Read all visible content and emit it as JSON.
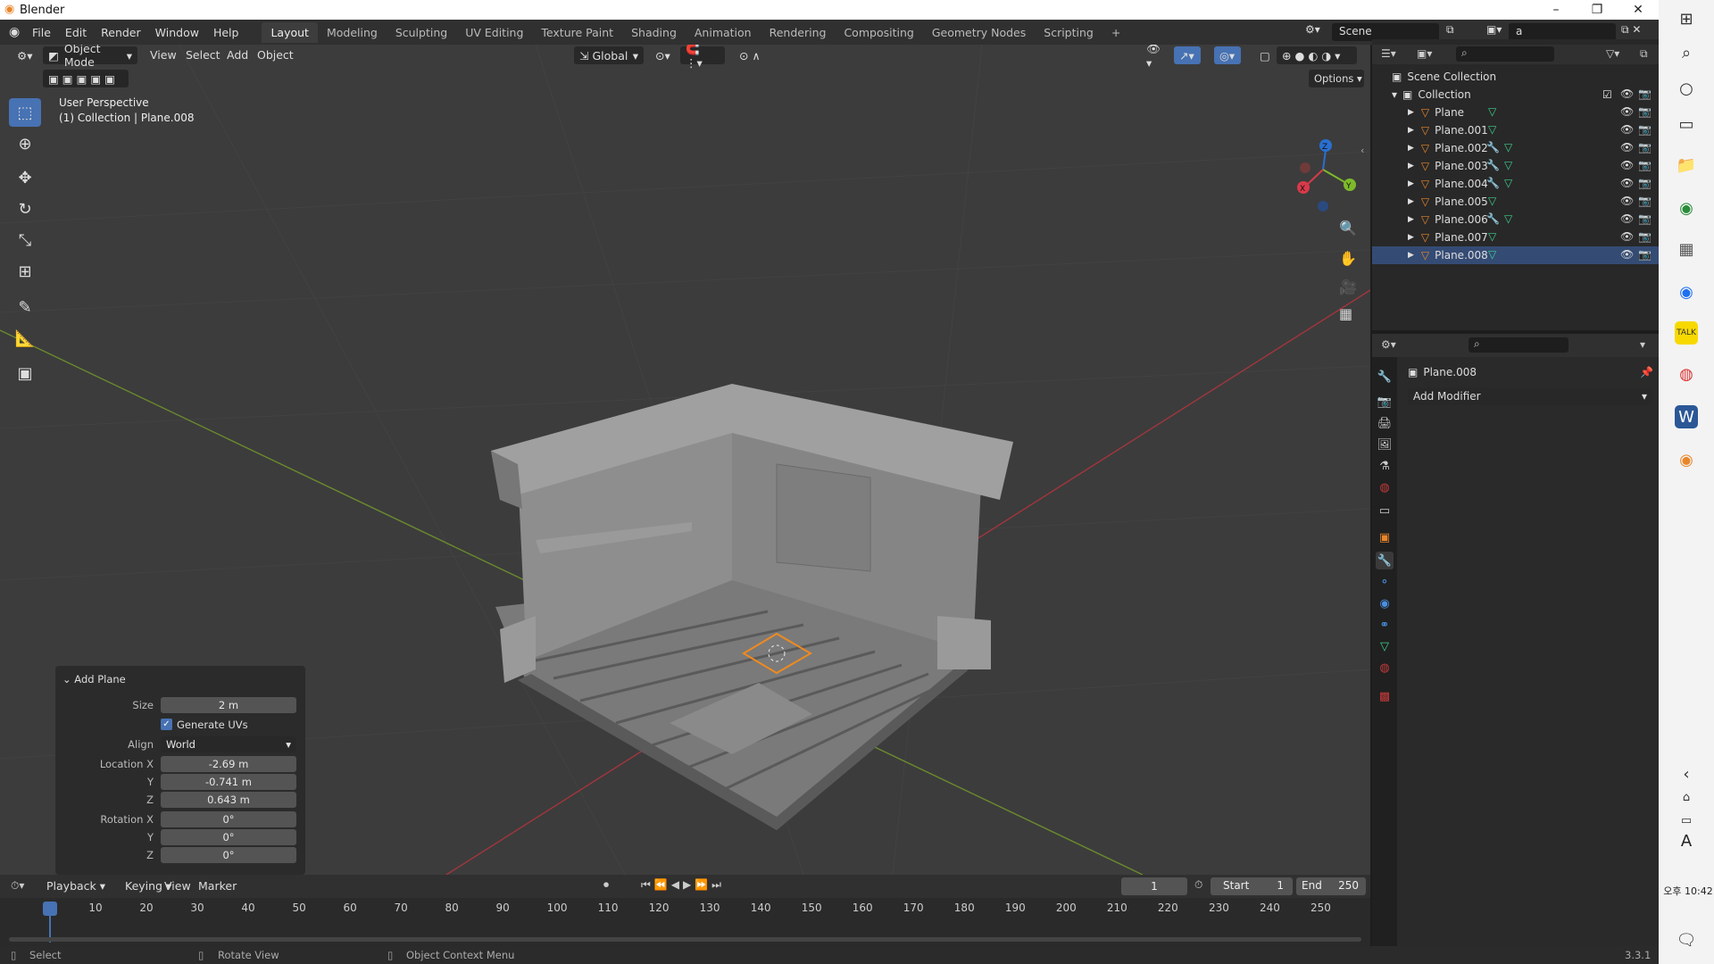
{
  "window": {
    "title": "Blender"
  },
  "menu": [
    "File",
    "Edit",
    "Render",
    "Window",
    "Help"
  ],
  "workspaces": [
    "Layout",
    "Modeling",
    "Sculpting",
    "UV Editing",
    "Texture Paint",
    "Shading",
    "Animation",
    "Rendering",
    "Compositing",
    "Geometry Nodes",
    "Scripting"
  ],
  "scene": {
    "name": "Scene",
    "view_layer": "a"
  },
  "viewport_header": {
    "mode": "Object Mode",
    "menus": [
      "View",
      "Select",
      "Add",
      "Object"
    ],
    "transform": "Global",
    "options": "Options"
  },
  "viewport": {
    "perspective": "User Perspective",
    "collection_info": "(1) Collection | Plane.008"
  },
  "gizmo": {
    "x": "X",
    "y": "Y",
    "z": "Z"
  },
  "outliner": {
    "scene_collection": "Scene Collection",
    "collection": "Collection",
    "objects": [
      {
        "name": "Plane",
        "has_modifier": false
      },
      {
        "name": "Plane.001",
        "has_modifier": false
      },
      {
        "name": "Plane.002",
        "has_modifier": true
      },
      {
        "name": "Plane.003",
        "has_modifier": true
      },
      {
        "name": "Plane.004",
        "has_modifier": true
      },
      {
        "name": "Plane.005",
        "has_modifier": false
      },
      {
        "name": "Plane.006",
        "has_modifier": true
      },
      {
        "name": "Plane.007",
        "has_modifier": false
      },
      {
        "name": "Plane.008",
        "has_modifier": false,
        "selected": true
      }
    ]
  },
  "properties": {
    "object_name": "Plane.008",
    "add_modifier": "Add Modifier"
  },
  "add_plane": {
    "title": "Add Plane",
    "size_label": "Size",
    "size": "2 m",
    "generate_uvs_label": "Generate UVs",
    "generate_uvs": true,
    "align_label": "Align",
    "align": "World",
    "location_x_label": "Location X",
    "location_x": "-2.69 m",
    "location_y_label": "Y",
    "location_y": "-0.741 m",
    "location_z_label": "Z",
    "location_z": "0.643 m",
    "rotation_x_label": "Rotation X",
    "rotation_x": "0°",
    "rotation_y_label": "Y",
    "rotation_y": "0°",
    "rotation_z_label": "Z",
    "rotation_z": "0°"
  },
  "timeline": {
    "menus": [
      "Playback",
      "Keying",
      "View",
      "Marker"
    ],
    "current_frame": "1",
    "start_label": "Start",
    "start": "1",
    "end_label": "End",
    "end": "250",
    "ticks": [
      "1",
      "10",
      "20",
      "30",
      "40",
      "50",
      "60",
      "70",
      "80",
      "90",
      "100",
      "110",
      "120",
      "130",
      "140",
      "150",
      "160",
      "170",
      "180",
      "190",
      "200",
      "210",
      "220",
      "230",
      "240",
      "250"
    ]
  },
  "statusbar": {
    "select": "Select",
    "rotate": "Rotate View",
    "context": "Object Context Menu",
    "version": "3.3.1"
  },
  "taskbar": {
    "time": "오후 10:42",
    "ime": "A"
  },
  "colors": {
    "accent": "#4772b3",
    "selected_row": "#344b74",
    "mesh_icon": "#e8862a",
    "data_icon": "#3ecf8e",
    "viewport_bg": "#3c3c3c"
  }
}
